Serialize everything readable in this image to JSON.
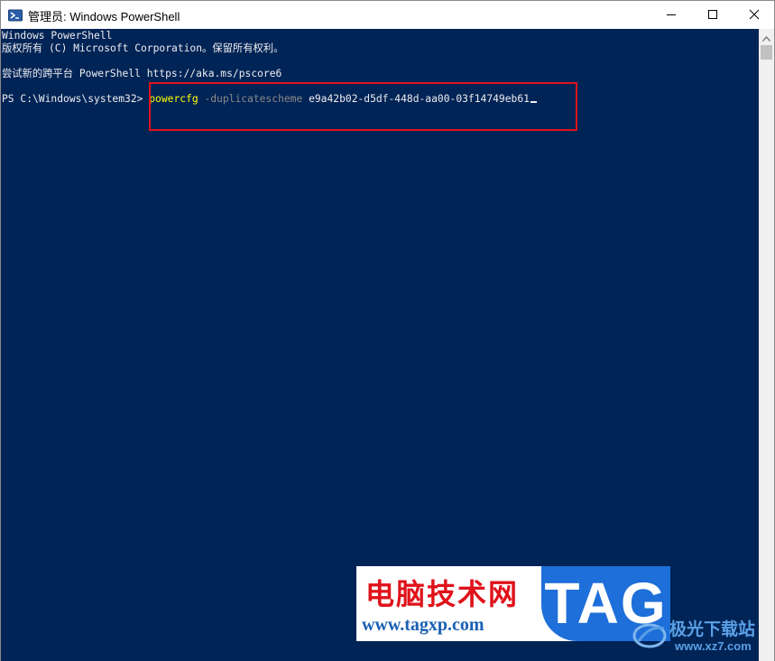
{
  "window": {
    "title": "管理员: Windows PowerShell"
  },
  "controls": {
    "minimize_icon": "minimize-icon",
    "maximize_icon": "maximize-icon",
    "close_icon": "close-icon"
  },
  "console": {
    "lines": [
      "Windows PowerShell",
      "版权所有 (C) Microsoft Corporation。保留所有权利。",
      "尝试新的跨平台 PowerShell https://aka.ms/pscore6"
    ],
    "prompt": "PS C:\\Windows\\system32> ",
    "command": "powercfg",
    "parameter": " -duplicatescheme",
    "argument": " e9a42b02-d5df-448d-aa00-03f14749eb61"
  },
  "colors": {
    "console_background": "#012456",
    "console_text": "#eeedf0",
    "command_color": "#ffff00",
    "parameter_color": "#8a8a8a",
    "highlight_box": "#e0121a"
  },
  "watermark": {
    "site_name_cn": "电脑技术网",
    "site_url": "www.tagxp.com",
    "tag": "TAG",
    "secondary_name_cn": "极光下载站",
    "secondary_url": "www.xz7.com"
  }
}
